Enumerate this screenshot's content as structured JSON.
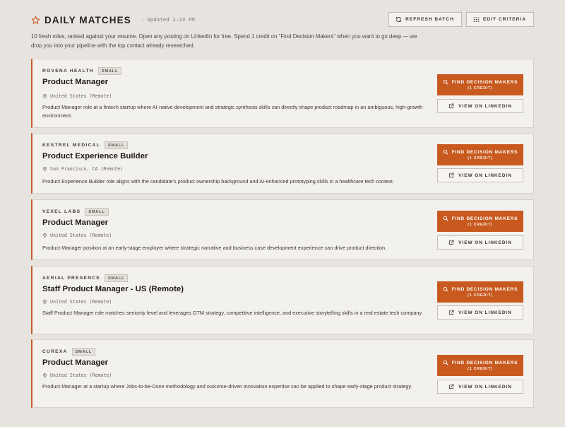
{
  "header": {
    "title": "DAILY MATCHES",
    "updated_prefix": "·",
    "updated": "Updated 2:23 PM",
    "refresh_label": "REFRESH BATCH",
    "edit_label": "EDIT CRITERIA"
  },
  "intro": "10 fresh roles, ranked against your resume. Open any posting on LinkedIn for free. Spend 1 credit on \"Find Decision Makers\" when you want to go deep — we drop you into your pipeline with the top contact already researched.",
  "actions": {
    "find_label": "FIND DECISION MAKERS",
    "find_sub": "(1 CREDIT)",
    "linkedin_label": "VIEW ON LINKEDIN"
  },
  "icons": {
    "title": "star-icon",
    "refresh": "refresh-icon",
    "edit": "grid-icon",
    "location": "map-pin-icon",
    "find": "search-icon",
    "linkedin": "external-link-icon"
  },
  "colors": {
    "accent": "#c8591f",
    "background": "#e7e4df",
    "card": "#f3f1ed"
  },
  "jobs": [
    {
      "company": "ROVENA HEALTH",
      "size": "SMALL",
      "title": "Product Manager",
      "location": "United States (Remote)",
      "description": "Product Manager role at a fintech startup where AI-native development and strategic synthesis skills can directly shape product roadmap in an ambiguous, high-growth environment."
    },
    {
      "company": "KESTREL MEDICAL",
      "size": "SMALL",
      "title": "Product Experience Builder",
      "location": "San Francisco, CA (Remote)",
      "description": "Product Experience Builder role aligns with the candidate's product ownership background and AI-enhanced prototyping skills in a healthcare tech context."
    },
    {
      "company": "VEXEL LABS",
      "size": "SMALL",
      "title": "Product Manager",
      "location": "United States (Remote)",
      "description": "Product Manager position at an early-stage employer where strategic narrative and business case development experience can drive product direction."
    },
    {
      "company": "AERIAL PRESENCE",
      "size": "SMALL",
      "title": "Staff Product Manager - US (Remote)",
      "location": "United States (Remote)",
      "description": "Staff Product Manager role matches seniority level and leverages GTM strategy, competitive intelligence, and executive storytelling skills in a real estate tech company."
    },
    {
      "company": "CUREXA",
      "size": "SMALL",
      "title": "Product Manager",
      "location": "United States (Remote)",
      "description": "Product Manager at a startup where Jobs-to-be-Done methodology and outcome-driven innovation expertise can be applied to shape early-stage product strategy."
    }
  ]
}
